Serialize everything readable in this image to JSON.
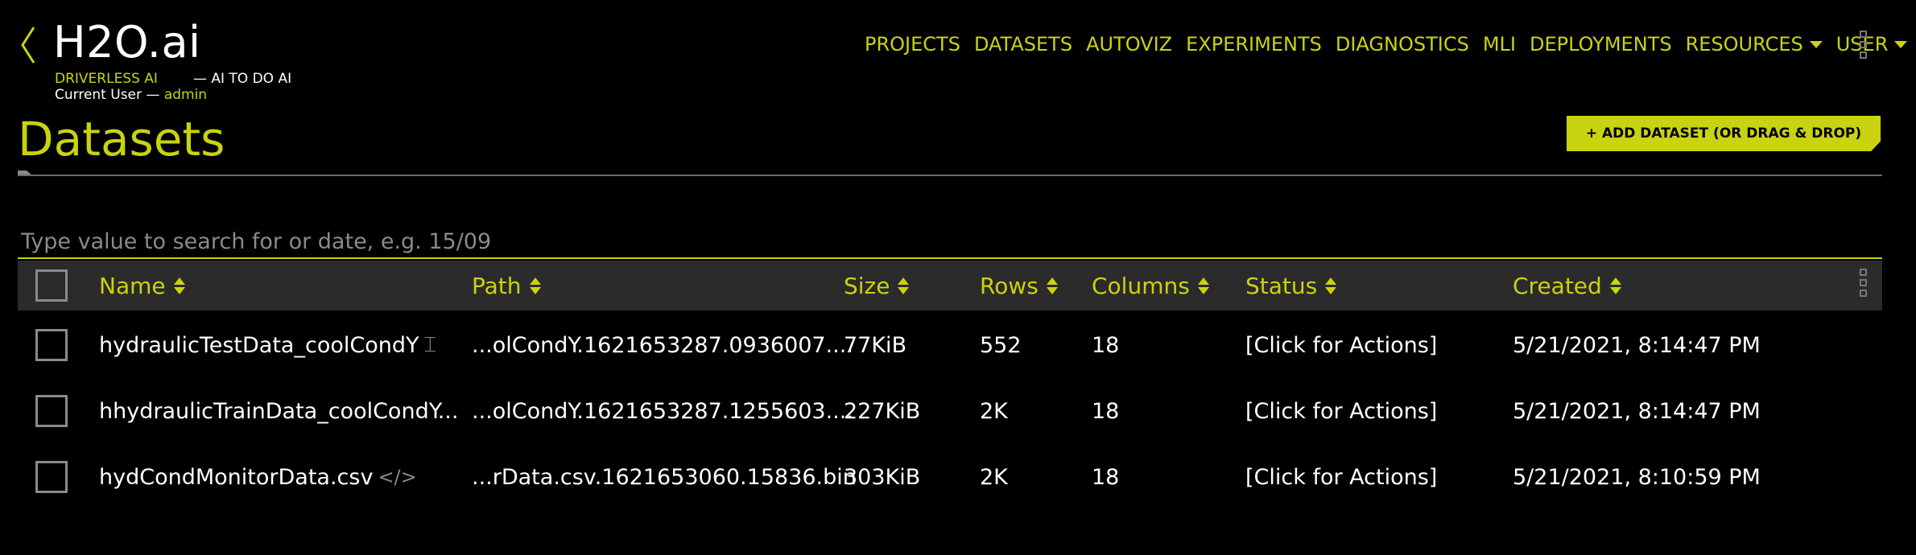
{
  "header": {
    "logo": "H2O.ai",
    "product": "DRIVERLESS AI",
    "tagline": "— AI TO DO AI",
    "current_user_label": "Current User —",
    "current_user": "admin"
  },
  "nav": {
    "items": [
      {
        "label": "PROJECTS"
      },
      {
        "label": "DATASETS"
      },
      {
        "label": "AUTOVIZ"
      },
      {
        "label": "EXPERIMENTS"
      },
      {
        "label": "DIAGNOSTICS"
      },
      {
        "label": "MLI"
      },
      {
        "label": "DEPLOYMENTS"
      },
      {
        "label": "RESOURCES",
        "dropdown": true
      },
      {
        "label": "USER",
        "dropdown": true
      }
    ]
  },
  "page": {
    "title": "Datasets",
    "add_button": "+ ADD DATASET (OR DRAG & DROP)",
    "search_placeholder": "Type value to search for or date, e.g. 15/09",
    "search_value": ""
  },
  "table": {
    "columns": [
      "Name",
      "Path",
      "Size",
      "Rows",
      "Columns",
      "Status",
      "Created"
    ],
    "rows": [
      {
        "name": "hydraulicTestData_coolCondY",
        "path": "...olCondY.1621653287.0936007....",
        "size": "77KiB",
        "rows": "552",
        "columns": "18",
        "status": "[Click for Actions]",
        "created": "5/21/2021, 8:14:47 PM"
      },
      {
        "name": "hhydraulicTrainData_coolCondY...",
        "path": "...olCondY.1621653287.1255603....",
        "size": "227KiB",
        "rows": "2K",
        "columns": "18",
        "status": "[Click for Actions]",
        "created": "5/21/2021, 8:14:47 PM"
      },
      {
        "name": "hydCondMonitorData.csv",
        "path": "...rData.csv.1621653060.15836.bin",
        "size": "303KiB",
        "rows": "2K",
        "columns": "18",
        "status": "[Click for Actions]",
        "created": "5/21/2021, 8:10:59 PM"
      }
    ]
  },
  "icons": {
    "back": "chevron-left-icon",
    "menu": "kebab-menu-icon",
    "sort": "sort-arrows-icon",
    "rename": "text-cursor-icon",
    "code": "code-icon"
  },
  "colors": {
    "accent": "#c9d30f",
    "background": "#000000",
    "header_row": "#2b2b2b",
    "muted": "#8a8a8a"
  }
}
